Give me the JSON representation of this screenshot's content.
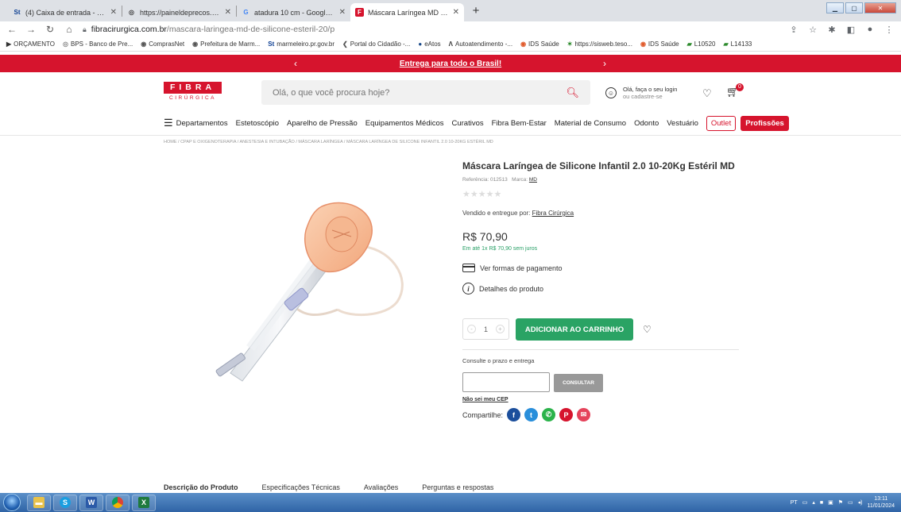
{
  "browser": {
    "tabs": [
      {
        "icon": "St",
        "title": "(4) Caixa de entrada - E-mail - m",
        "active": false
      },
      {
        "icon": "◎",
        "title": "https://paineldeprecos.planejam",
        "active": false
      },
      {
        "icon": "G",
        "title": "atadura 10 cm - Google Shoppin",
        "active": false
      },
      {
        "icon": "F",
        "title": "Máscara Laríngea MD 2.0 de Silic",
        "active": true
      }
    ],
    "url_host": "fibracirurgica.com.br",
    "url_path": "/mascara-laringea-md-de-silicone-esteril-20/p",
    "bookmarks": [
      "ORÇAMENTO",
      "BPS - Banco de Pre...",
      "ComprasNet",
      "Prefeitura de Marm...",
      "marmeleiro.pr.gov.br",
      "Portal do Cidadão -...",
      "eAtos",
      "Autoatendimento -...",
      "IDS Saúde",
      "https://sisweb.teso...",
      "IDS Saúde",
      "L10520",
      "L14133"
    ]
  },
  "site": {
    "promo": "Entrega para todo o Brasil!",
    "logo_top": "FIBRA",
    "logo_bottom": "CIRÚRGICA",
    "search_placeholder": "Olá, o que você procura hoje?",
    "login_line1": "Olá, faça o seu login",
    "login_line2": "ou cadastre-se",
    "cart_count": "0",
    "nav": {
      "departments": "Departamentos",
      "items": [
        "Estetoscópio",
        "Aparelho de Pressão",
        "Equipamentos Médicos",
        "Curativos",
        "Fibra Bem-Estar",
        "Material de Consumo",
        "Odonto",
        "Vestuário"
      ],
      "outlet": "Outlet",
      "profissoes": "Profissões"
    },
    "breadcrumb": "HOME / CPAP E OXIGENOTERAPIA / ANESTESIA E INTUBAÇÃO / MÁSCARA LARÍNGEA / MÁSCARA LARÍNGEA DE SILICONE INFANTIL 2.0 10-20KG ESTÉRIL MD"
  },
  "product": {
    "name": "Máscara Laríngea de Silicone Infantil 2.0 10-20Kg Estéril MD",
    "reference_label": "Referência: 012513",
    "brand_label": "Marca:",
    "brand": "MD",
    "stars": "★★★★★",
    "rating": 0,
    "seller_label": "Vendido e entregue por:",
    "seller": "Fibra Cirúrgica",
    "price": "R$ 70,90",
    "installments": "Em até 1x R$ 70,90 sem juros",
    "payment_link": "Ver formas de pagamento",
    "details_link": "Detalhes do produto",
    "qty_minus": "-",
    "qty_value": "1",
    "qty_plus": "+",
    "add_to_cart": "ADICIONAR AO CARRINHO",
    "shipping_label": "Consulte o prazo e entrega",
    "consult_button": "CONSULTAR",
    "no_cep": "Não sei meu CEP",
    "share_label": "Compartilhe:"
  },
  "description_tabs": [
    "Descrição do Produto",
    "Especificações Técnicas",
    "Avaliações",
    "Perguntas e respostas"
  ],
  "taskbar": {
    "lang": "PT",
    "time": "13:11",
    "date": "11/01/2024"
  },
  "colors": {
    "brand_red": "#d6142d",
    "cart_green": "#2aa364"
  }
}
